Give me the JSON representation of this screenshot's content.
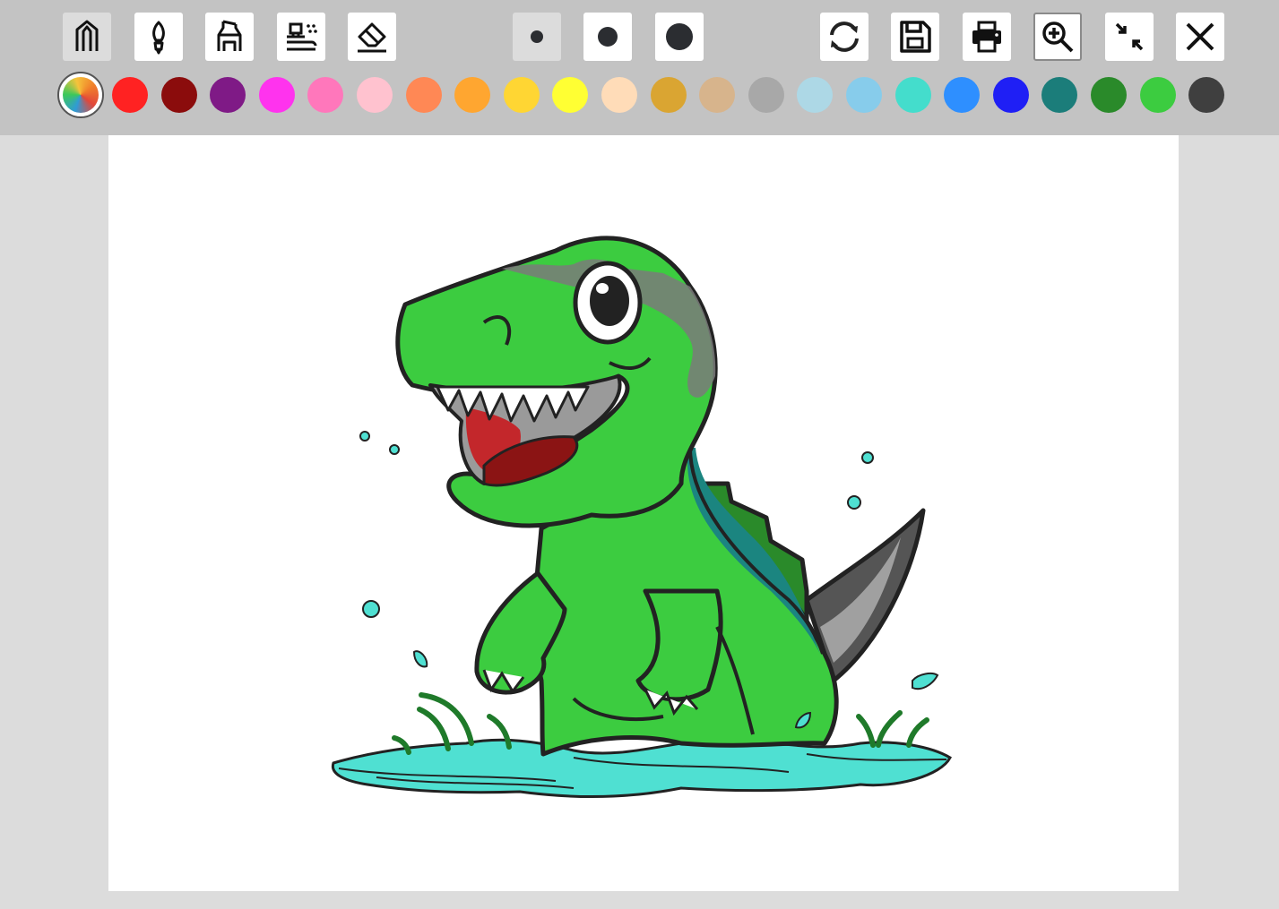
{
  "toolbar": {
    "tools": [
      "pencil-icon",
      "brush-icon",
      "marker-icon",
      "spray-icon",
      "eraser-icon"
    ],
    "active_tool": "pencil-icon",
    "sizes": [
      "small",
      "medium",
      "large"
    ],
    "active_size": "small",
    "actions": [
      "refresh-icon",
      "save-icon",
      "print-icon",
      "zoom-in-icon",
      "exit-fullscreen-icon",
      "close-icon"
    ],
    "active_action": "zoom-in-icon"
  },
  "palette": {
    "selected": "rainbow",
    "colors": [
      "#ff2222",
      "#8b0c0c",
      "#7f1a86",
      "#ff33ee",
      "#ff77bb",
      "#ffc2cf",
      "#ff8855",
      "#ffa630",
      "#ffd633",
      "#ffff33",
      "#ffdcb8",
      "#daa532",
      "#d7b48c",
      "#a8a8a8",
      "#add8e6",
      "#87cceb",
      "#44ddcc",
      "#2e8fff",
      "#1f1ff5",
      "#1b7d7a",
      "#2a8a2a",
      "#3ccc40",
      "#3f3f3f"
    ]
  },
  "drawing": {
    "subject": "dinosaur-coloring-picture",
    "colors": {
      "body": "#3ccc40",
      "water": "#4fe0d2",
      "mouth": "#c3272b",
      "tongue": "#8b1414",
      "back": "#1b8580",
      "spikes": "#2a8a2a",
      "tail": "#555555",
      "outline": "#222222"
    }
  }
}
